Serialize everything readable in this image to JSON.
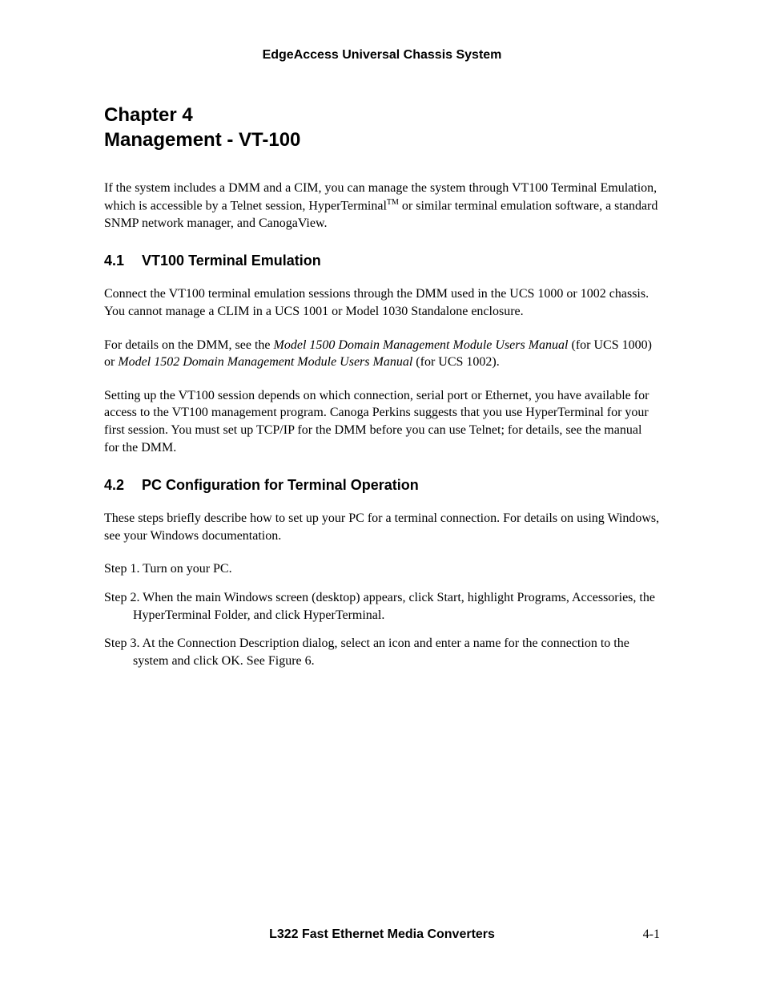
{
  "header": {
    "title": "EdgeAccess Universal Chassis System"
  },
  "chapter": {
    "line1": "Chapter 4",
    "line2": "Management - VT-100"
  },
  "intro": {
    "part1": "If the system includes a DMM and a CIM, you can manage the system through VT100 Terminal Emulation, which is accessible by a Telnet session, HyperTerminal",
    "tm": "TM",
    "part2": " or similar terminal emulation software, a standard SNMP network manager, and CanogaView."
  },
  "section41": {
    "number": "4.1",
    "title": "VT100 Terminal Emulation",
    "para1": "Connect the VT100 terminal emulation sessions through the DMM used in the UCS 1000 or 1002 chassis.  You cannot manage a CLIM in a UCS 1001 or Model 1030 Standalone enclosure.",
    "para2_a": "For details on the DMM, see the ",
    "para2_i1": "Model 1500 Domain Management Module Users Manual",
    "para2_b": " (for UCS 1000) or ",
    "para2_i2": "Model 1502 Domain Management Module Users Manual",
    "para2_c": " (for UCS 1002).",
    "para3": "Setting up the VT100 session depends on which connection, serial port or Ethernet, you have available for access to the VT100 management program.  Canoga Perkins suggests that you use HyperTerminal for your first session.  You must set up TCP/IP for the DMM before you can use Telnet; for details, see the manual for the DMM."
  },
  "section42": {
    "number": "4.2",
    "title": "PC Configuration for Terminal Operation",
    "para1": "These steps briefly describe how to set up your PC for a terminal connection.  For details on using Windows, see your Windows documentation.",
    "step1": "Step 1.  Turn on your PC.",
    "step2": "Step 2.  When the main Windows screen (desktop) appears, click Start, highlight Programs, Accessories, the HyperTerminal Folder, and click HyperTerminal.",
    "step3": "Step 3.  At the Connection Description dialog, select an icon and enter a name for the connection to the system and click OK.  See Figure 6."
  },
  "footer": {
    "title": "L322 Fast Ethernet Media Converters",
    "page": "4-1"
  }
}
